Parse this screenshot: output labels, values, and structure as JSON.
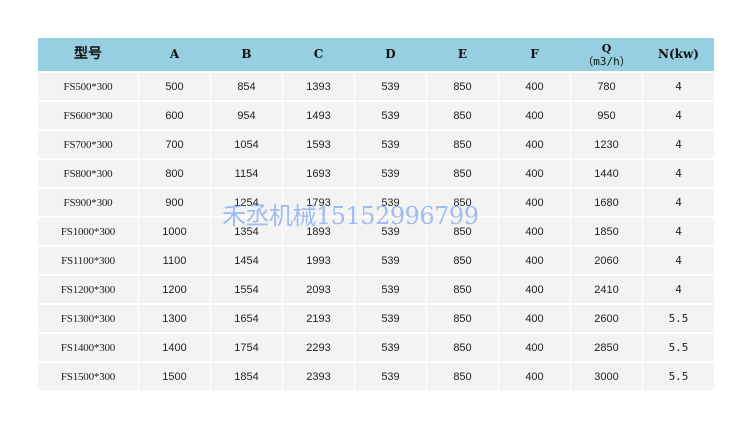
{
  "table": {
    "headers": {
      "model": "型号",
      "a": "A",
      "b": "B",
      "c": "C",
      "d": "D",
      "e": "E",
      "f": "F",
      "q": "Q",
      "q_unit": "（m3/h）",
      "n": "N(kw)"
    },
    "rows": [
      [
        "FS500*300",
        "500",
        "854",
        "1393",
        "539",
        "850",
        "400",
        "780",
        "4"
      ],
      [
        "FS600*300",
        "600",
        "954",
        "1493",
        "539",
        "850",
        "400",
        "950",
        "4"
      ],
      [
        "FS700*300",
        "700",
        "1054",
        "1593",
        "539",
        "850",
        "400",
        "1230",
        "4"
      ],
      [
        "FS800*300",
        "800",
        "1154",
        "1693",
        "539",
        "850",
        "400",
        "1440",
        "4"
      ],
      [
        "FS900*300",
        "900",
        "1254",
        "1793",
        "539",
        "850",
        "400",
        "1680",
        "4"
      ],
      [
        "FS1000*300",
        "1000",
        "1354",
        "1893",
        "539",
        "850",
        "400",
        "1850",
        "4"
      ],
      [
        "FS1100*300",
        "1100",
        "1454",
        "1993",
        "539",
        "850",
        "400",
        "2060",
        "4"
      ],
      [
        "FS1200*300",
        "1200",
        "1554",
        "2093",
        "539",
        "850",
        "400",
        "2410",
        "4"
      ],
      [
        "FS1300*300",
        "1300",
        "1654",
        "2193",
        "539",
        "850",
        "400",
        "2600",
        "5.5"
      ],
      [
        "FS1400*300",
        "1400",
        "1754",
        "2293",
        "539",
        "850",
        "400",
        "2850",
        "5.5"
      ],
      [
        "FS1500*300",
        "1500",
        "1854",
        "2393",
        "539",
        "850",
        "400",
        "3000",
        "5.5"
      ]
    ]
  },
  "watermark": "禾丞机械15152996799",
  "colors": {
    "header_bg": "#96cfe0",
    "row_bg": "#f3f3f3",
    "watermark": "#5a8ceb"
  }
}
